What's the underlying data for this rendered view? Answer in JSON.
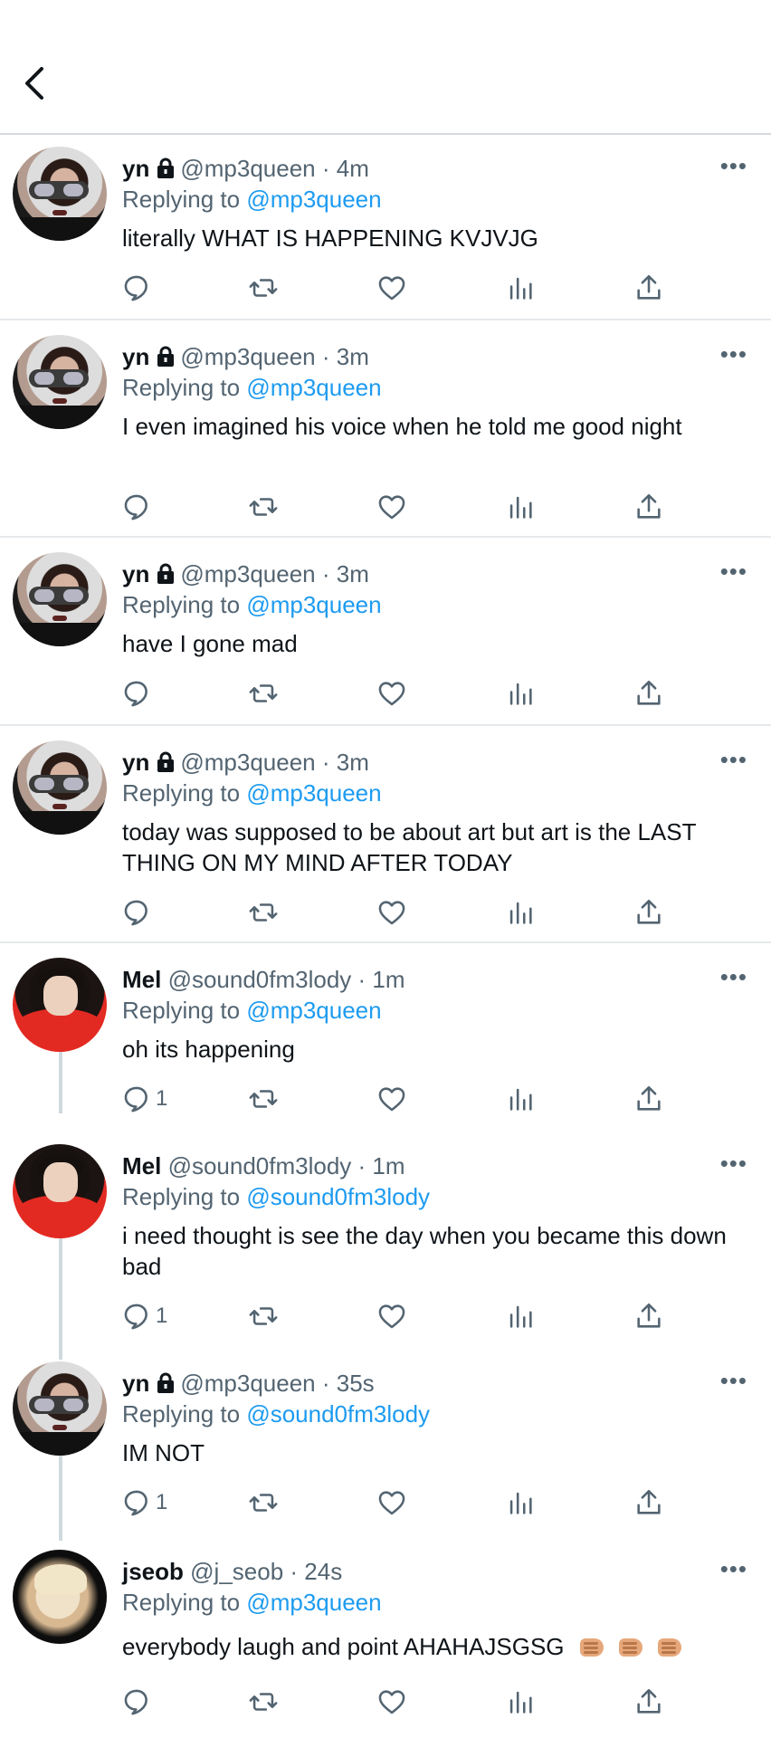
{
  "tweets": [
    {
      "name": "yn",
      "handle": "@mp3queen",
      "time": "4m",
      "replying_prefix": "Replying to",
      "replying_to": "@mp3queen",
      "text": "literally WHAT IS HAPPENING KVJVJG",
      "reply_count": ""
    },
    {
      "name": "yn",
      "handle": "@mp3queen",
      "time": "3m",
      "replying_prefix": "Replying to",
      "replying_to": "@mp3queen",
      "text": "I even imagined his voice when he told me good night",
      "reply_count": ""
    },
    {
      "name": "yn",
      "handle": "@mp3queen",
      "time": "3m",
      "replying_prefix": "Replying to",
      "replying_to": "@mp3queen",
      "text": "have I gone mad",
      "reply_count": ""
    },
    {
      "name": "yn",
      "handle": "@mp3queen",
      "time": "3m",
      "replying_prefix": "Replying to",
      "replying_to": "@mp3queen",
      "text": "today was supposed to be about art but art is the LAST THING ON MY MIND AFTER TODAY",
      "reply_count": ""
    },
    {
      "name": "Mel",
      "handle": "@sound0fm3lody",
      "time": "1m",
      "replying_prefix": "Replying to",
      "replying_to": "@mp3queen",
      "text": "oh its happening",
      "reply_count": "1"
    },
    {
      "name": "Mel",
      "handle": "@sound0fm3lody",
      "time": "1m",
      "replying_prefix": "Replying to",
      "replying_to": "@sound0fm3lody",
      "text": "i need thought is see the day when you became this down bad",
      "reply_count": "1"
    },
    {
      "name": "yn",
      "handle": "@mp3queen",
      "time": "35s",
      "replying_prefix": "Replying to",
      "replying_to": "@sound0fm3lody",
      "text": "IM NOT",
      "reply_count": "1"
    },
    {
      "name": "jseob",
      "handle": "@j_seob",
      "time": "24s",
      "replying_prefix": "Replying to",
      "replying_to": "@mp3queen",
      "text": "everybody laugh and point AHAHAJSGSG",
      "reply_count": ""
    }
  ],
  "icons": {
    "back": "chevron-left-icon",
    "lock": "lock-icon",
    "more": "more-icon",
    "reply": "reply-icon",
    "retweet": "retweet-icon",
    "like": "heart-icon",
    "analytics": "analytics-icon",
    "share": "share-icon"
  },
  "colors": {
    "link": "#1d9bf0",
    "secondary": "#536471",
    "text": "#0f1419"
  }
}
